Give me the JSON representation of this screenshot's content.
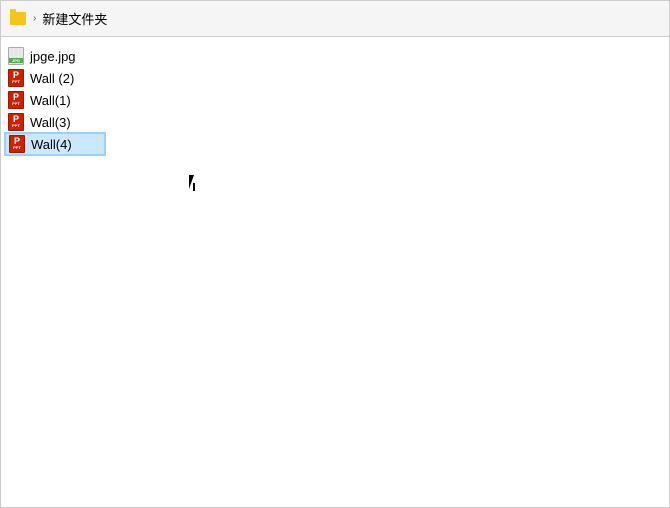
{
  "window": {
    "title": "新建文件夹"
  },
  "breadcrumb": {
    "separator": "›",
    "folder": "新建文件夹"
  },
  "files": [
    {
      "name": "jpge.jpg",
      "type": "jpg",
      "selected": false
    },
    {
      "name": "Wall (2)",
      "type": "ppt",
      "selected": false
    },
    {
      "name": "Wall(1)",
      "type": "ppt",
      "selected": false
    },
    {
      "name": "Wall(3)",
      "type": "ppt",
      "selected": false
    },
    {
      "name": "Wall(4)",
      "type": "ppt",
      "selected": true
    }
  ]
}
